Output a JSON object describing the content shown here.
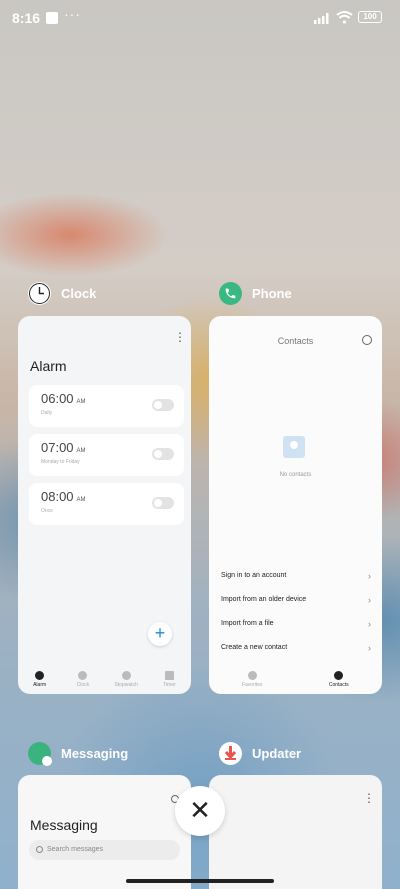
{
  "status_bar": {
    "time": "8:16",
    "more": "···",
    "battery": "100"
  },
  "apps": {
    "clock": {
      "name": "Clock",
      "screen_title": "Alarm",
      "alarms": [
        {
          "time": "06:00",
          "ampm": "AM",
          "subtitle": "Daily"
        },
        {
          "time": "07:00",
          "ampm": "AM",
          "subtitle": "Monday to Friday"
        },
        {
          "time": "08:00",
          "ampm": "AM",
          "subtitle": "Once"
        }
      ],
      "add": "+",
      "tabs": [
        "Alarm",
        "Clock",
        "Stopwatch",
        "Timer"
      ]
    },
    "phone": {
      "name": "Phone",
      "screen_title": "Contacts",
      "empty_text": "No contacts",
      "actions": [
        "Sign in to an account",
        "Import from an older device",
        "Import from a file",
        "Create a new contact"
      ],
      "tabs": [
        "Favorites",
        "Contacts"
      ]
    },
    "messaging": {
      "name": "Messaging",
      "screen_title": "Messaging",
      "search_placeholder": "Search messages"
    },
    "updater": {
      "name": "Updater"
    }
  },
  "close_button": "✕",
  "colors": {
    "phone_icon": "#39b881",
    "messaging_icon": "#3bb37f",
    "updater_icon": "#e8574e",
    "accent": "#1a8ae0"
  }
}
